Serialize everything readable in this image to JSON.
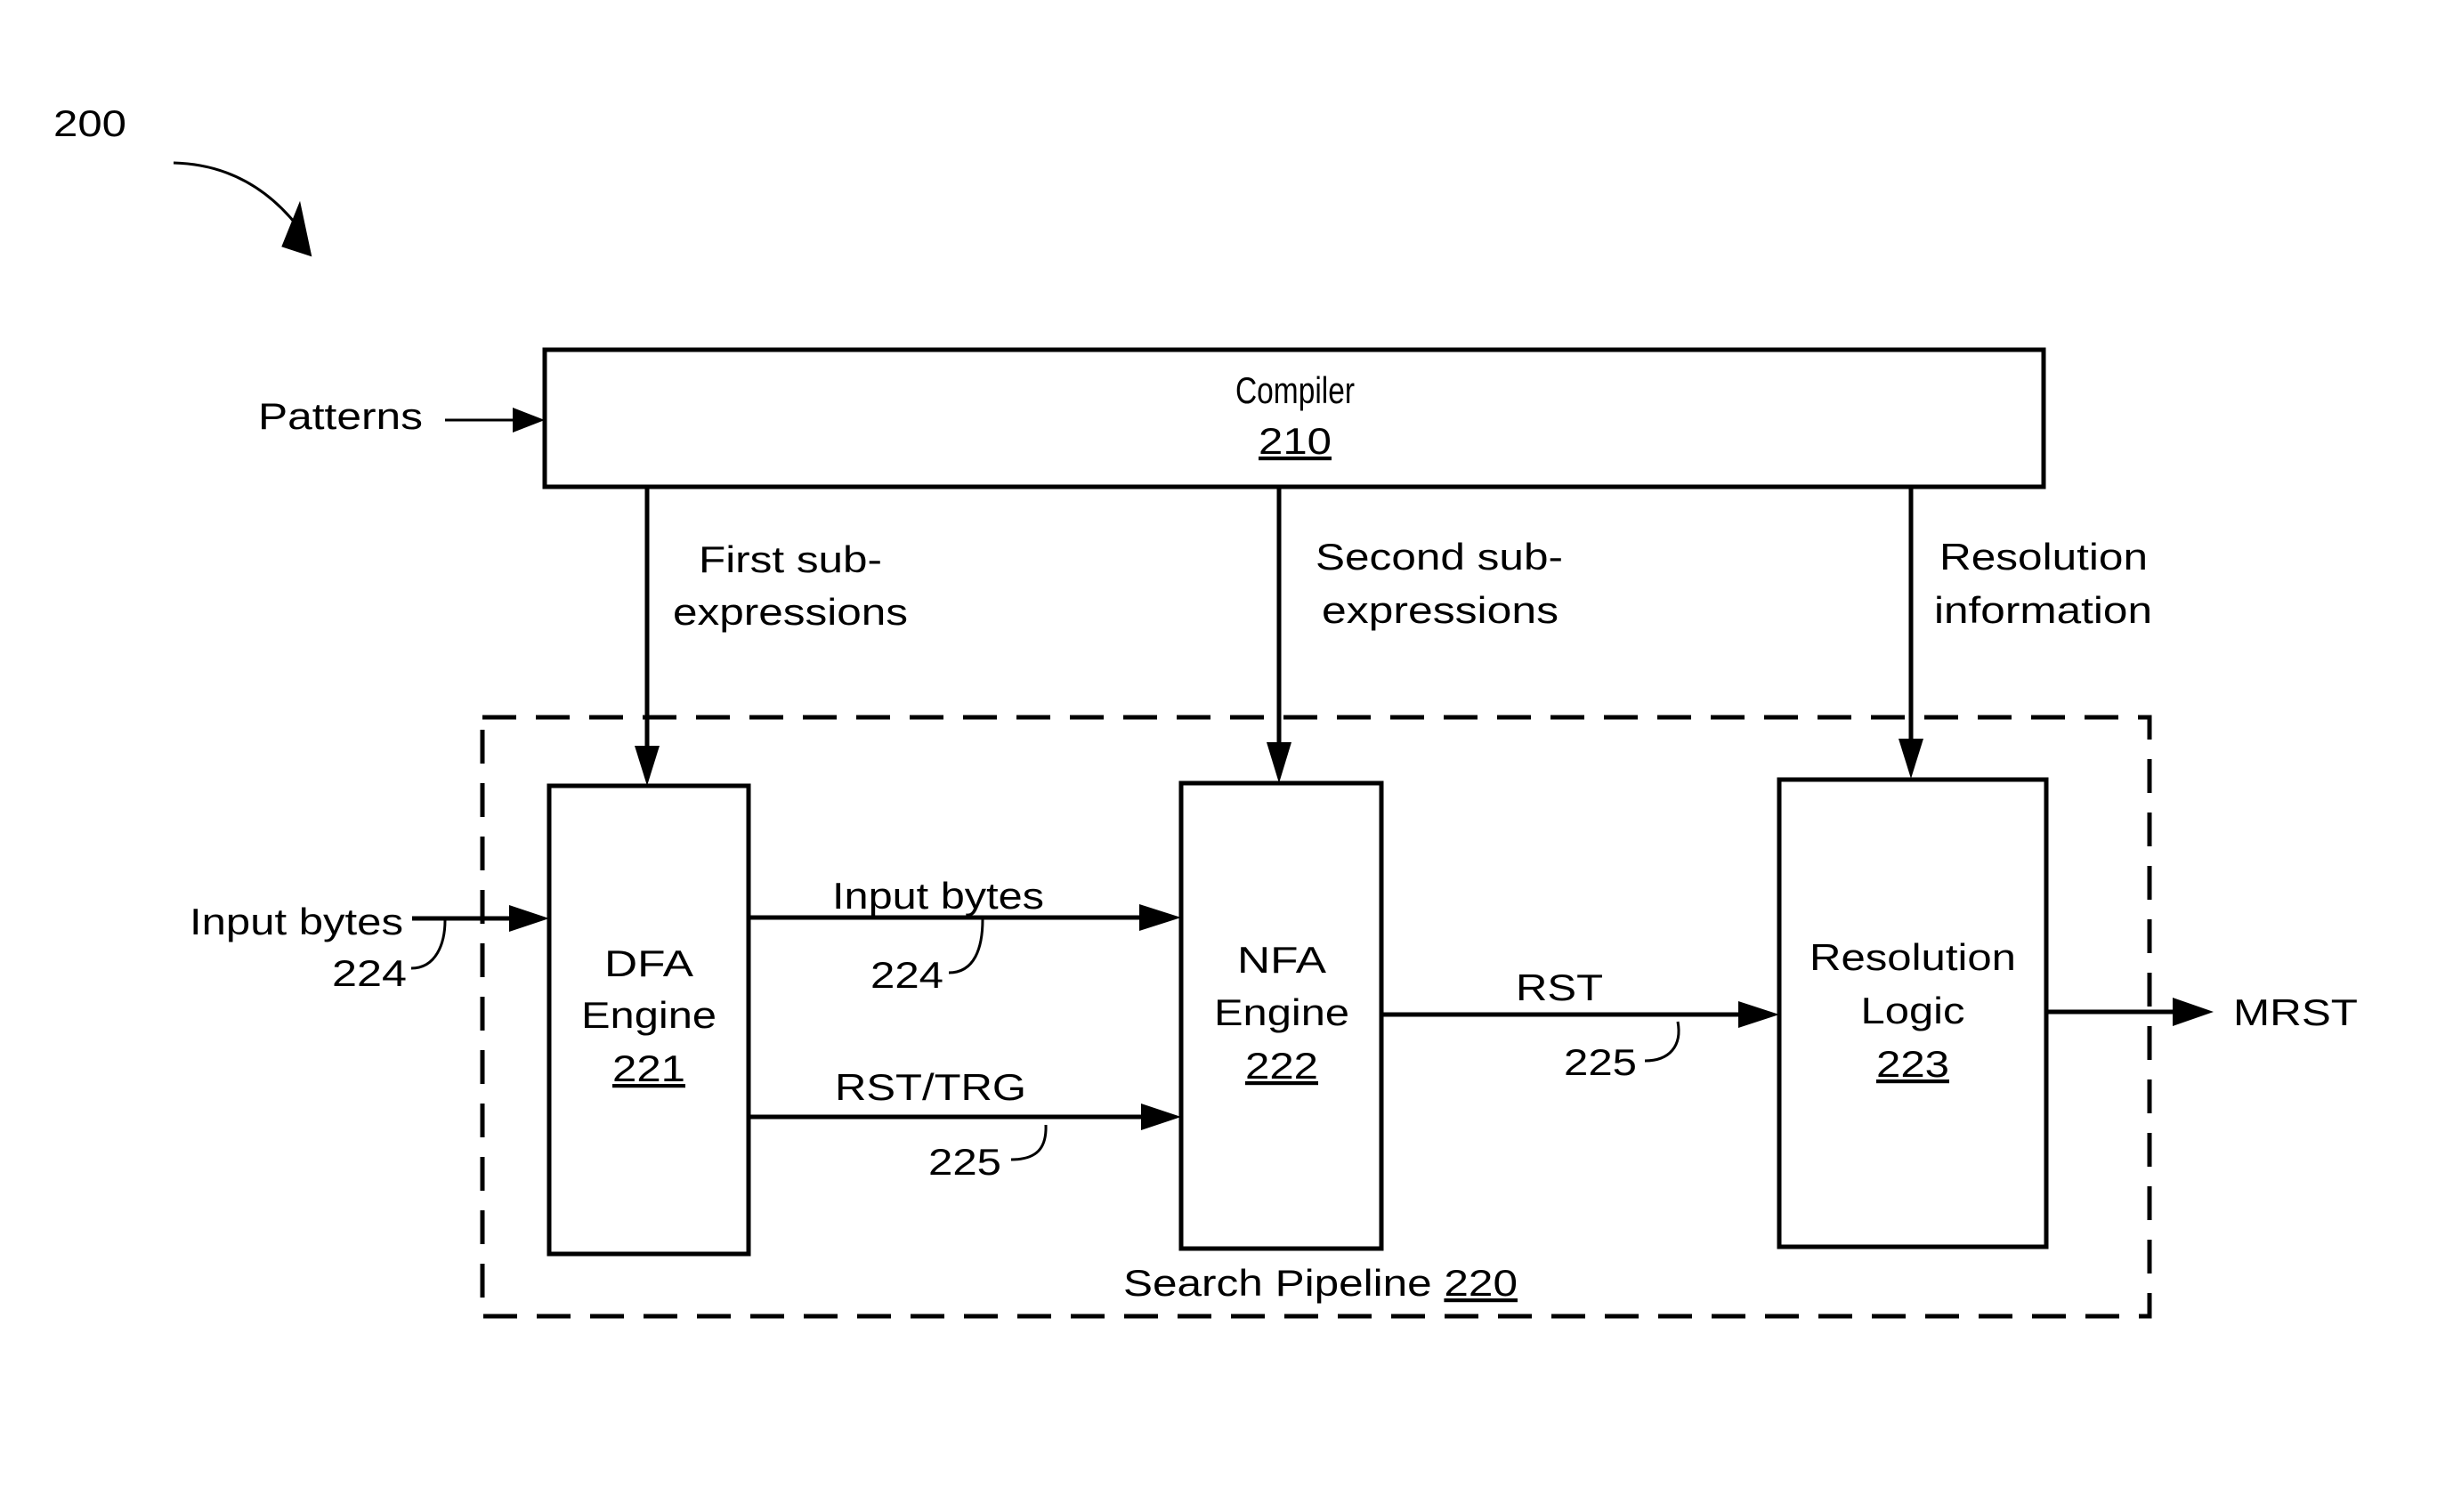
{
  "figure": {
    "ref_number": "200"
  },
  "colors": {
    "ink": "#000000",
    "background": "#ffffff"
  },
  "inputs": {
    "patterns": "Patterns",
    "input_bytes": "Input bytes",
    "input_bytes_ref": "224"
  },
  "compiler": {
    "title": "Compiler",
    "ref": "210"
  },
  "compiler_outputs": {
    "first_line1": "First sub-",
    "first_line2": "expressions",
    "second_line1": "Second sub-",
    "second_line2": "expressions",
    "resolution_line1": "Resolution",
    "resolution_line2": "information"
  },
  "pipeline": {
    "label": "Search Pipeline",
    "ref": "220"
  },
  "dfa": {
    "line1": "DFA",
    "line2": "Engine",
    "ref": "221"
  },
  "nfa": {
    "line1": "NFA",
    "line2": "Engine",
    "ref": "222"
  },
  "resolution_logic": {
    "line1": "Resolution",
    "line2": "Logic",
    "ref": "223"
  },
  "signals": {
    "dfa_to_nfa_bytes": "Input bytes",
    "dfa_to_nfa_bytes_ref": "224",
    "dfa_to_nfa_rst": "RST/TRG",
    "dfa_to_nfa_rst_ref": "225",
    "nfa_to_res": "RST",
    "nfa_to_res_ref": "225"
  },
  "output": {
    "label": "MRST"
  }
}
